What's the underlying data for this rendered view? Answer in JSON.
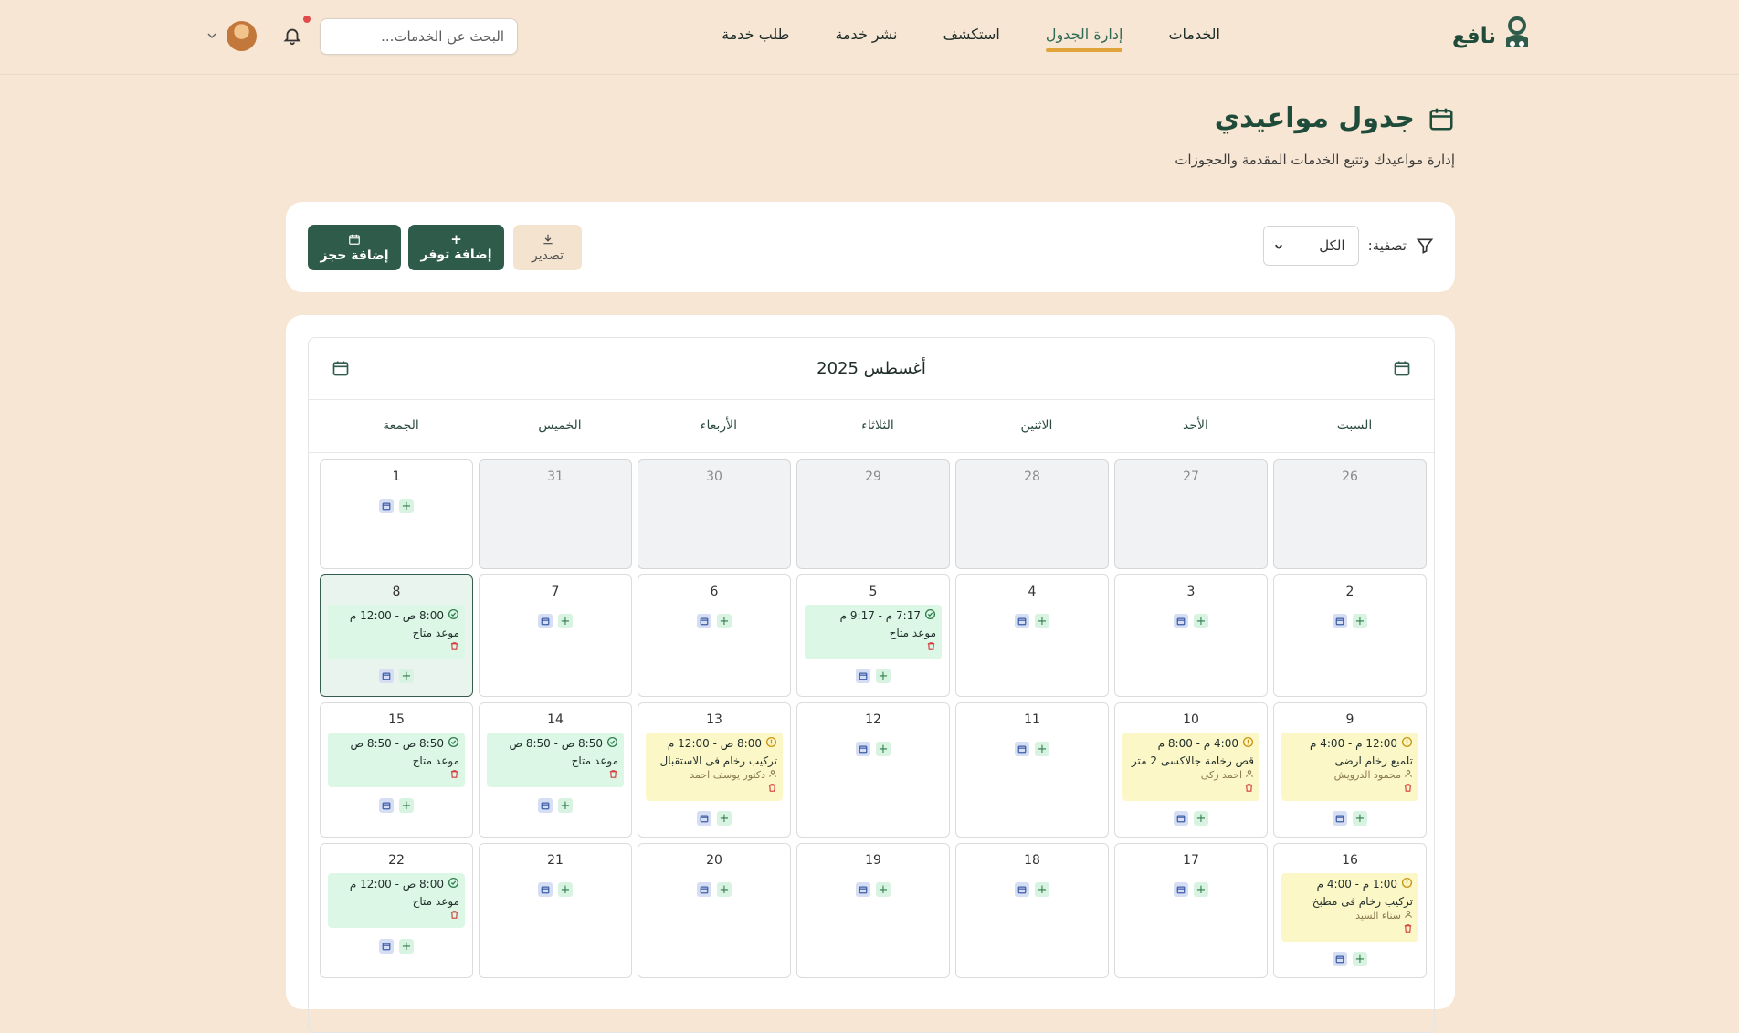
{
  "brand": {
    "name": "نافع"
  },
  "nav": {
    "links": [
      "الخدمات",
      "إدارة الجدول",
      "استكشف",
      "نشر خدمة",
      "طلب خدمة"
    ],
    "active_index": 1
  },
  "search": {
    "placeholder": "البحث عن الخدمات..."
  },
  "page": {
    "title": "جدول مواعيدي",
    "subtitle": "إدارة مواعيدك وتتبع الخدمات المقدمة والحجوزات"
  },
  "filter": {
    "label": "تصفية:",
    "selected": "الكل"
  },
  "toolbar": {
    "add_booking": "إضافة حجز",
    "add_availability": "إضافة توفر",
    "export": "تصدير"
  },
  "calendar": {
    "month_label": "أغسطس 2025",
    "weekdays": [
      "السبت",
      "الأحد",
      "الاثنين",
      "الثلاثاء",
      "الأربعاء",
      "الخميس",
      "الجمعة"
    ],
    "rows": [
      [
        {
          "day": "26",
          "other": true
        },
        {
          "day": "27",
          "other": true
        },
        {
          "day": "28",
          "other": true
        },
        {
          "day": "29",
          "other": true
        },
        {
          "day": "30",
          "other": true
        },
        {
          "day": "31",
          "other": true
        },
        {
          "day": "1",
          "other": false
        }
      ],
      [
        {
          "day": "2"
        },
        {
          "day": "3"
        },
        {
          "day": "4"
        },
        {
          "day": "5",
          "event": {
            "type": "green",
            "time": "7:17 م - 9:17 م",
            "title": "موعد متاح"
          }
        },
        {
          "day": "6"
        },
        {
          "day": "7"
        },
        {
          "day": "8",
          "today": true,
          "event": {
            "type": "green",
            "time": "8:00 ص - 12:00 م",
            "title": "موعد متاح"
          }
        }
      ],
      [
        {
          "day": "9",
          "event": {
            "type": "yellow",
            "time": "12:00 م - 4:00 م",
            "title": "تلميع رخام ارضى",
            "person": "محمود الدرويش"
          }
        },
        {
          "day": "10",
          "event": {
            "type": "yellow",
            "time": "4:00 م - 8:00 م",
            "title": "قص رخامة جالاكسى 2 متر",
            "person": "احمد زكى"
          }
        },
        {
          "day": "11"
        },
        {
          "day": "12"
        },
        {
          "day": "13",
          "event": {
            "type": "yellow",
            "time": "8:00 ص - 12:00 م",
            "title": "تركيب رخام فى الاستقبال",
            "person": "دكتور يوسف احمد"
          }
        },
        {
          "day": "14",
          "event": {
            "type": "green",
            "time": "8:50 ص - 8:50 ص",
            "title": "موعد متاح"
          }
        },
        {
          "day": "15",
          "event": {
            "type": "green",
            "time": "8:50 ص - 8:50 ص",
            "title": "موعد متاح"
          }
        }
      ],
      [
        {
          "day": "16",
          "event": {
            "type": "yellow",
            "time": "1:00 م - 4:00 م",
            "title": "تركيب رخام فى مطبخ",
            "person": "سناء السيد"
          }
        },
        {
          "day": "17"
        },
        {
          "day": "18"
        },
        {
          "day": "19"
        },
        {
          "day": "20"
        },
        {
          "day": "21"
        },
        {
          "day": "22",
          "event": {
            "type": "green",
            "time": "8:00 ص - 12:00 م",
            "title": "موعد متاح"
          }
        }
      ]
    ]
  },
  "colors": {
    "accent_dark": "#2f5b4b",
    "underline": "#e1a43a",
    "event_green": "#dcf7e6",
    "event_yellow": "#fcf7c7"
  },
  "icons": {
    "bell": "bell-icon",
    "calendar": "calendar-icon",
    "filter": "filter-icon",
    "export": "download-icon",
    "plus": "plus-icon"
  }
}
